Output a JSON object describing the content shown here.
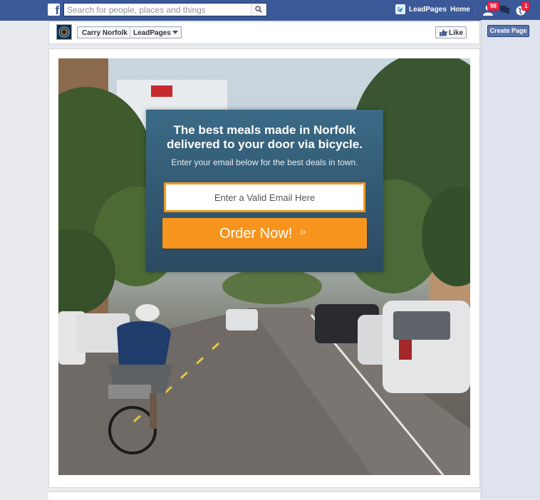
{
  "topbar": {
    "search_placeholder": "Search for people, places and things",
    "page_link": "LeadPages",
    "home_link": "Home",
    "friend_requests_count": "98",
    "notifications_count": "1"
  },
  "right_rail": {
    "create_page_label": "Create Page"
  },
  "page_header": {
    "page_name": "Carry Norfolk",
    "app_name": "LeadPages",
    "like_label": "Like"
  },
  "optin": {
    "title_line1": "The best meals made in Norfolk",
    "title_line2": "delivered to your door via bicycle.",
    "subtitle": "Enter your email below for the best deals in town.",
    "email_placeholder": "Enter a Valid Email Here",
    "cta_label": "Order Now!",
    "cta_arrow": "»"
  },
  "colors": {
    "facebook_blue": "#3b5998",
    "cta_orange": "#f7941d",
    "optin_panel": "#335a74"
  }
}
